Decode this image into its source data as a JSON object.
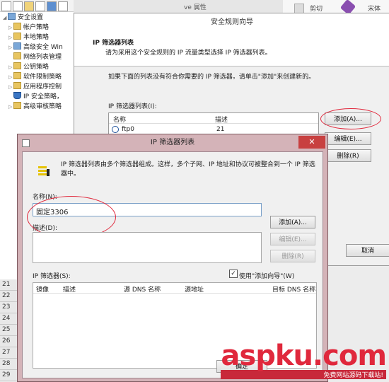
{
  "toolbar": {
    "icons": [
      "back-icon",
      "forward-icon",
      "folder-icon",
      "list-icon",
      "help-icon",
      "panel-icon"
    ]
  },
  "tree": {
    "items": [
      {
        "label": "安全设置",
        "level": 0
      },
      {
        "label": "帐户策略",
        "level": 1
      },
      {
        "label": "本地策略",
        "level": 1
      },
      {
        "label": "高级安全 Win",
        "level": 1
      },
      {
        "label": "网络列表管理",
        "level": 1
      },
      {
        "label": "公钥策略",
        "level": 1
      },
      {
        "label": "软件限制策略",
        "level": 1
      },
      {
        "label": "应用程序控制",
        "level": 1
      },
      {
        "label": "IP 安全策略，",
        "level": 1
      },
      {
        "label": "高级审核策略",
        "level": 1
      }
    ]
  },
  "row_numbers": [
    "21",
    "22",
    "23",
    "24",
    "25",
    "26",
    "27",
    "28",
    "29"
  ],
  "ribbon": {
    "cut_label": "剪切",
    "extra_label": "宋体"
  },
  "background_window": {
    "title_fragment": "ve 属性"
  },
  "wizard": {
    "title": "安全规则向导",
    "header_title": "IP 筛选器列表",
    "header_desc": "请为采用这个安全规则的 IP 流量类型选择 IP 筛选器列表。",
    "instruction": "如果下面的列表没有符合你需要的 IP 筛选器，请单击\"添加\"来创建新的。",
    "list_label": "IP 筛选器列表(I):",
    "columns": [
      "名称",
      "描述"
    ],
    "rows": [
      {
        "name": "ftp0",
        "desc": "21"
      }
    ],
    "add_button": "添加(A)...",
    "edit_button": "编辑(E)...",
    "delete_button": "删除(R)",
    "cancel_button": "取消"
  },
  "dialog": {
    "title": "IP 筛选器列表",
    "description": "IP 筛选器列表由多个筛选器组成。这样，多个子网、IP 地址和协议可被整合到一个 IP 筛选器中。",
    "name_label": "名称(N):",
    "name_value": "固定3306",
    "desc_label": "描述(D):",
    "add_button": "添加(A)...",
    "edit_button": "编辑(E)...",
    "delete_button": "删除(R)",
    "filters_label": "IP 筛选器(S):",
    "use_wizard_label": "使用\"添加向导\"(W)",
    "use_wizard_checked": true,
    "columns": [
      "镜像",
      "描述",
      "源 DNS 名称",
      "源地址",
      "目标 DNS 名称"
    ],
    "ok_button": "确定",
    "close_glyph": "✕"
  },
  "watermark": {
    "main": "aspku.com",
    "sub": "免费网站源码下载站!"
  },
  "colors": {
    "accent_red": "#e0283c",
    "dialog_frame": "#d4b3b8",
    "watermark_red": "#e0283c",
    "watermark_dark": "#333333"
  }
}
